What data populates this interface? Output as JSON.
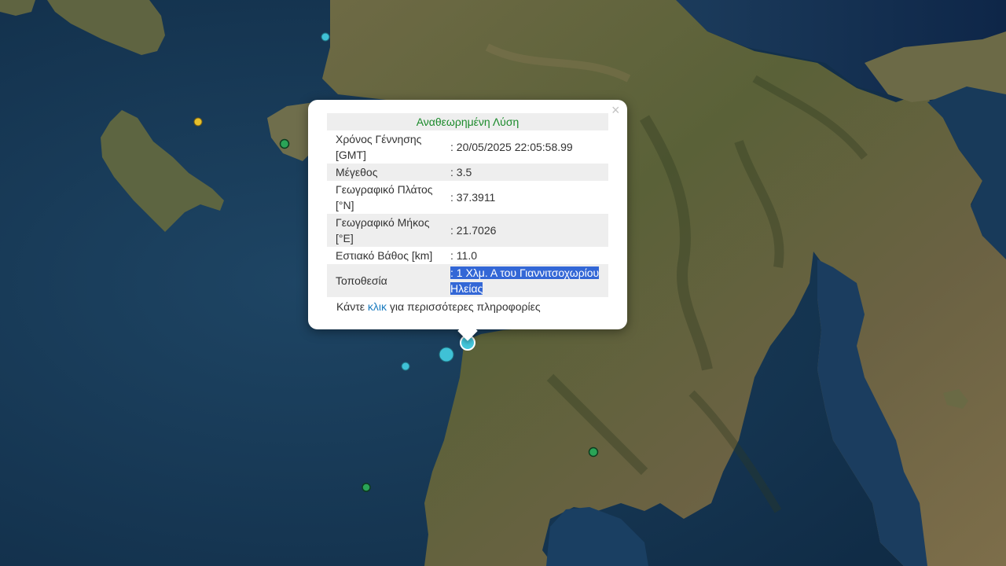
{
  "map": {
    "quake_markers": [
      {
        "name": "marker-north-cyan",
        "color": "#3fc1d6"
      },
      {
        "name": "marker-zakynthos-yellow",
        "color": "#e6c02c"
      },
      {
        "name": "marker-kyllini-green",
        "color": "#2aa457"
      },
      {
        "name": "marker-selected",
        "color": "#45c7dc"
      },
      {
        "name": "marker-large-cyan",
        "color": "#3fc1d6"
      },
      {
        "name": "marker-small-cyan",
        "color": "#3fc1d6"
      },
      {
        "name": "marker-inland-green",
        "color": "#2aa457"
      },
      {
        "name": "marker-sea-green",
        "color": "#2aa457"
      }
    ]
  },
  "popup": {
    "close_label": "×",
    "header": "Αναθεωρημένη Λύση",
    "rows": [
      {
        "label": "Χρόνος Γέννησης [GMT]",
        "value": ": 20/05/2025 22:05:58.99"
      },
      {
        "label": "Μέγεθος",
        "value": ": 3.5"
      },
      {
        "label": "Γεωγραφικό Πλάτος [°N]",
        "value": ": 37.3911"
      },
      {
        "label": "Γεωγραφικό Μήκος [°E]",
        "value": ": 21.7026"
      },
      {
        "label": "Εστιακό Βάθος [km]",
        "value": ": 11.0"
      },
      {
        "label": "Τοποθεσία",
        "value": ": 1 Χλμ. Α του Γιαννιτσοχωρίου Ηλείας"
      }
    ],
    "more_prefix": "Κάντε ",
    "more_link": "κλικ",
    "more_suffix": " για περισσότερες πληροφορίες"
  }
}
